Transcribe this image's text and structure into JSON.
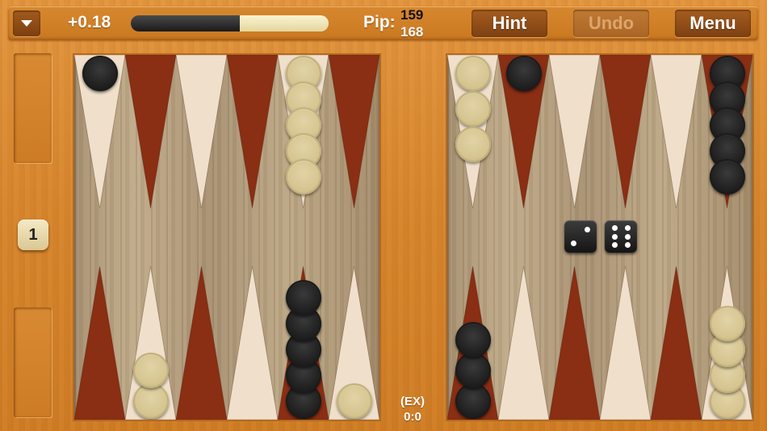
{
  "topbar": {
    "equity": "+0.18",
    "equity_fraction": 0.55,
    "pip_label": "Pip:",
    "pip_black": "159",
    "pip_white": "168",
    "hint_label": "Hint",
    "undo_label": "Undo",
    "menu_label": "Menu",
    "menu_arrow_icon": "chevron-down-icon"
  },
  "cube": {
    "value": "1"
  },
  "score": {
    "mode": "(EX)",
    "value": "0:0"
  },
  "colors": {
    "wood_frame": "#d6852c",
    "dark_point": "#8a2e14",
    "light_point": "#f0e0cb",
    "black_checker": "#222222",
    "white_checker": "#d6c591"
  },
  "dice": [
    2,
    6
  ],
  "points": [
    {
      "point": 1,
      "color": "white",
      "count": 4
    },
    {
      "point": 6,
      "color": "black",
      "count": 3
    },
    {
      "point": 7,
      "color": "white",
      "count": 1
    },
    {
      "point": 8,
      "color": "black",
      "count": 5
    },
    {
      "point": 11,
      "color": "white",
      "count": 2
    },
    {
      "point": 13,
      "color": "black",
      "count": 1
    },
    {
      "point": 17,
      "color": "white",
      "count": 5
    },
    {
      "point": 19,
      "color": "white",
      "count": 3
    },
    {
      "point": 20,
      "color": "black",
      "count": 1
    },
    {
      "point": 24,
      "color": "black",
      "count": 5
    }
  ]
}
